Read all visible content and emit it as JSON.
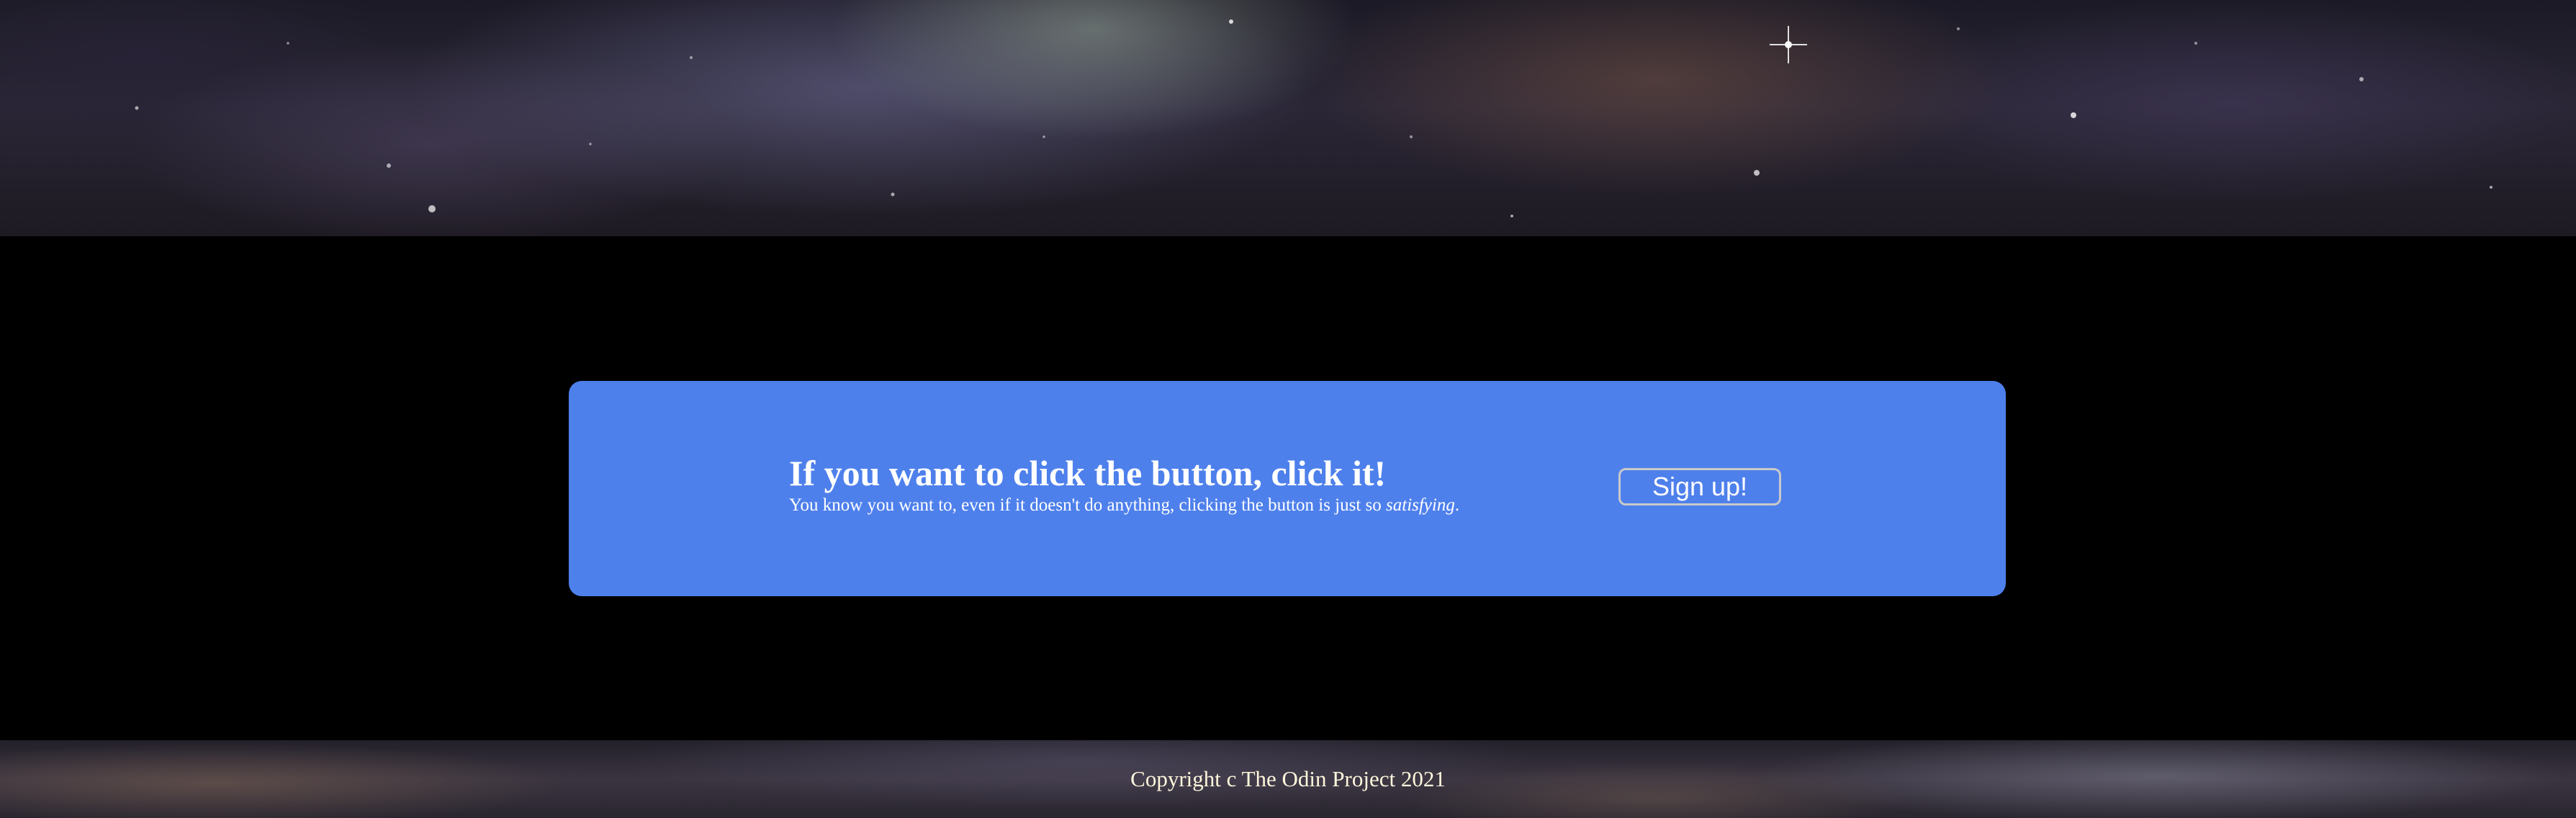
{
  "colors": {
    "card_background": "#4e80ec",
    "page_background": "#000000",
    "text": "#ffffff",
    "footer_text": "#fff6dc",
    "button_border": "#c9c9c9"
  },
  "hero": {
    "image": "space-nebula-image"
  },
  "cta": {
    "heading": "If you want to click the button, click it!",
    "subtext_before": "You know you want to, even if it doesn't do anything, clicking the button is just so ",
    "subtext_emphasis": "satisfying",
    "subtext_after": ".",
    "button_label": "Sign up!"
  },
  "footer": {
    "copyright": "Copyright c The Odin Project 2021",
    "image": "space-cloud-image"
  }
}
